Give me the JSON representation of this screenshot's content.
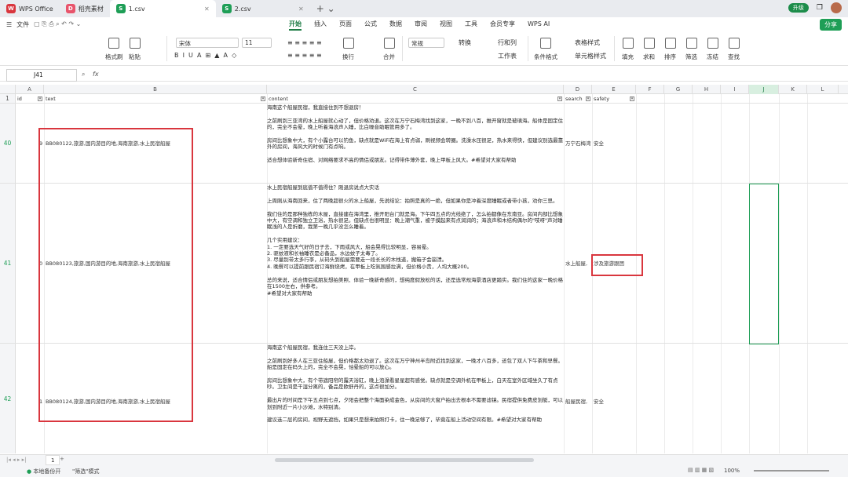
{
  "tabs": [
    {
      "label": "WPS Office",
      "icon": "W",
      "color": "#d9363e"
    },
    {
      "label": "稻壳素材",
      "icon": "D",
      "color": "#e8546b"
    },
    {
      "label": "1.csv",
      "icon": "S",
      "color": "#1e9e56"
    },
    {
      "label": "2.csv",
      "icon": "S",
      "color": "#1e9e56"
    }
  ],
  "header_right": {
    "upgrade": "升级"
  },
  "menubar": {
    "file": "文件",
    "menus": [
      "开始",
      "插入",
      "页面",
      "公式",
      "数据",
      "审阅",
      "视图",
      "工具",
      "会员专享"
    ],
    "wps_ai": "WPS AI",
    "share": "分享"
  },
  "ribbon": {
    "format_brush": "格式刷",
    "paste": "粘贴",
    "font": "宋体",
    "size": "11",
    "wrap": "换行",
    "merge": "合并",
    "format": "常规",
    "convert": "转换",
    "rowcol": "行和列",
    "worksheet": "工作表",
    "cond_format": "条件格式",
    "table_style": "表格样式",
    "cell_style": "单元格样式",
    "fill": "填充",
    "sum": "求和",
    "sort": "排序",
    "filter": "筛选",
    "freeze": "冻结",
    "find": "查找"
  },
  "formula": {
    "cell": "J41",
    "fx": "fx"
  },
  "columns": [
    "A",
    "B",
    "C",
    "D",
    "E",
    "F",
    "G",
    "H",
    "I",
    "J",
    "K",
    "L"
  ],
  "header_row": {
    "rownum": "1",
    "a": "id",
    "b": "text",
    "c": "content",
    "d": "search",
    "e": "safety"
  },
  "rows": [
    {
      "rownum": "40",
      "a": "9",
      "b": "BB080122,旅游,国内游目的地,海南旅游,水上民宿船屋",
      "d": "万宁石梅湾",
      "e": "安全",
      "content": "海南这个船屋民宿，我直接住到不想退房！\n\n之前刷到三亚湾的水上船屋就心动了，但价格劝退。这次在万宁石梅湾找到这家，一晚不到八百，推开窗就是玻璃海。船体是固定住的，完全不会晕，晚上听着海浪声入睡，比白噪音助眠管用多了。\n\n房间比想象中大，有个小露台可以钓鱼，缺点就是WiFi在海上有点弱，刷视频会转圈。洗澡水压很足，热水来得快，但建议别选最靠外的房间，海风大的时候门有点响。\n\n适合想体验新奇住宿、对网络要求不高的情侣或朋友。记得带件薄外套，晚上甲板上风大。#希望对大家有帮助"
    },
    {
      "rownum": "41",
      "a": "0",
      "b": "BB080123,旅游,国内游目的地,海南旅游,水上民宿船屋",
      "d": "水上船屋,",
      "e": "涉及旅游跟团",
      "content": "水上民宿船屋到底值不值得住？刚退房说点大实话\n\n上周刚从海南回来，住了两晚超很火的水上船屋，先说结论：拍照是真的一绝，但如果你是冲着深度睡眠或者带小孩，劝你三思。\n\n我们住的是那种独栋的木屋，直接建在海湾里，推开阳台门就是海。下午四五点的光线绝了，怎么拍都像在东南亚。房间内部比想象中大，有空调和独立卫浴，热水很足。但缺点也很明显：晚上潮气重，被子摸起来有点润润的；海浪声和木结构偶尔的\"吱呀\"声对睡眠浅的人是折磨，我第一晚几乎没怎么睡着。\n\n几个实用建议：\n1. 一定要选天气好的日子去，下雨或风大，船会晃得比较明显，容易晕。\n2. 驱蚊液和长袖睡衣是必备品，水边蚊子太毒了。\n3. 尽量别带太多行李，从码头到船屋需要走一段长长的木栈道，搬箱子会崩溃。\n4. 晚餐可以提前跟民宿订海鲜烧烤，在甲板上吃氛围感拉满，但价格小贵，人均大概200。\n\n总的来说，适合情侣或朋友想拍美照、体验一晚新奇感的，想纯度假放松的话，还是选常规海景酒店更踏实。我们住的这家一晚价格在1500左右，供参考。\n#希望对大家有帮助"
    },
    {
      "rownum": "42",
      "a": "1",
      "b": "BB080124,旅游,国内游目的地,海南旅游,水上民宿船屋",
      "d": "船屋民宿,",
      "e": "安全",
      "content": "海南这个船屋民宿，我连住三天没上岸。\n\n之前刷到好多人在三亚住船屋，但价格都太劝退了。这次在万宁神州半岛附近找到这家，一晚才八百多，还包了双人下午茶和早餐。船是固定在码头上的，完全不会晃，怕晕船的可以放心。\n\n房间比想象中大，有个带遮阳帘的露天浴缸，晚上泡澡看星星超有感觉。缺点就是空调外机在甲板上，白天在室外区域坐久了有点吵。卫生间是干湿分离的，备品是欧舒丹的，这点很加分。\n\n最出片的时间是下午五点到七点，夕阳会把整个海面染成金色，从房间的大窗户拍出去根本不需要滤镜。民宿提供免费皮划艇，可以划到附近一片小沙滩，水特别清。\n\n建议选二层的房间，视野无遮挡，如果只是想来拍照打卡，住一晚足够了，毕竟在船上活动空间有限。#希望对大家有帮助"
    }
  ],
  "sheet": {
    "name": "1"
  },
  "status": {
    "backup": "本地备份开",
    "mode": "\"筛选\"模式",
    "zoom": "100%"
  }
}
